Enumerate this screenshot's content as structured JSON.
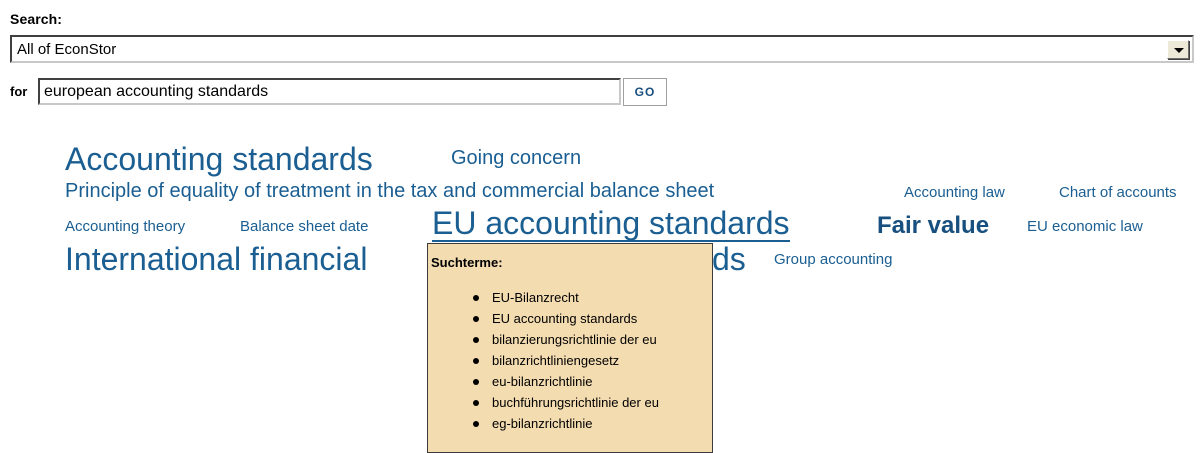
{
  "search": {
    "label": "Search:",
    "scope_value": "All of EconStor",
    "for_label": "for",
    "query_value": "european accounting standards",
    "go_label": "GO"
  },
  "tag_cloud": {
    "tags": [
      {
        "label": "Accounting standards",
        "size": "xl"
      },
      {
        "label": "Going concern",
        "size": "md"
      },
      {
        "label": "Principle of equality of treatment in the tax and commercial balance sheet",
        "size": "md"
      },
      {
        "label": "Accounting law",
        "size": "sm"
      },
      {
        "label": "Chart of accounts",
        "size": "sm"
      },
      {
        "label": "Accounting theory",
        "size": "sm"
      },
      {
        "label": "Balance sheet date",
        "size": "sm"
      },
      {
        "label": "EU accounting standards",
        "size": "xl",
        "hovered": true
      },
      {
        "label": "Fair value",
        "size": "bold"
      },
      {
        "label": "EU economic law",
        "size": "sm"
      },
      {
        "label": "International financial",
        "size": "xl"
      },
      {
        "label": "ds",
        "size": "xl"
      },
      {
        "label": "Group accounting",
        "size": "sm"
      }
    ]
  },
  "tooltip": {
    "title": "Suchterme:",
    "items": [
      "EU-Bilanzrecht",
      "EU accounting standards",
      "bilanzierungsrichtlinie der eu",
      "bilanzrichtliniengesetz",
      "eu-bilanzrichtlinie",
      "buchführungsrichtlinie der eu",
      "eg-bilanzrichtlinie"
    ]
  },
  "colors": {
    "link": "#1a5e92",
    "tooltip_bg": "#f4dcb1"
  }
}
